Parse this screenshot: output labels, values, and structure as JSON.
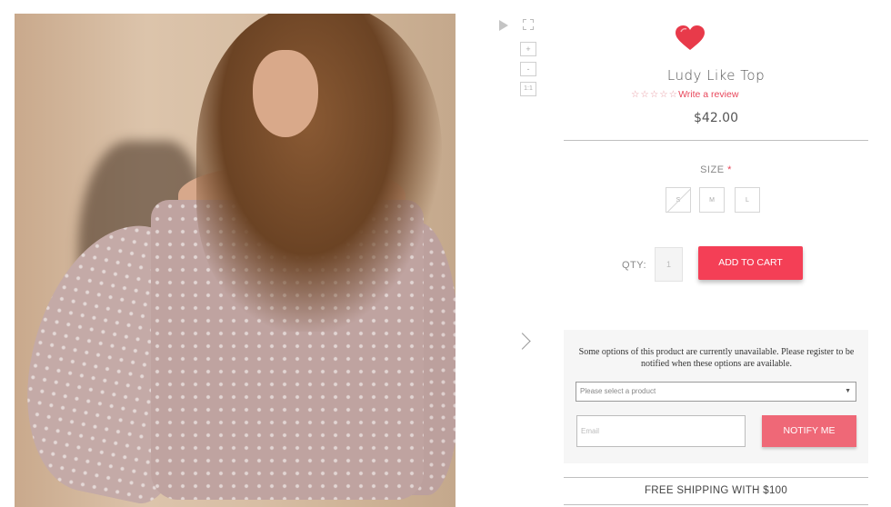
{
  "product": {
    "name": "Ludy Like Top",
    "rating_stars": "☆☆☆☆☆",
    "write_review": "Write a review",
    "price": "$42.00",
    "image_alt": "product-photo"
  },
  "gallery": {
    "zoom_in": "+",
    "zoom_out": "-",
    "reset": "1:1"
  },
  "options": {
    "size_label": "SIZE",
    "required_mark": "*",
    "sizes": [
      "S",
      "M",
      "L"
    ]
  },
  "purchase": {
    "qty_label": "QTY:",
    "qty_value": "1",
    "add_to_cart": "ADD TO CART"
  },
  "notify": {
    "message": "Some options of this product are currently unavailable. Please register to be notified when these options are available.",
    "select_placeholder": "Please select a product",
    "email_placeholder": "Email",
    "button": "NOTIFY ME"
  },
  "promo": {
    "free_shipping": "FREE SHIPPING WITH $100"
  },
  "colors": {
    "accent": "#f43f56",
    "notify_button": "#ef6877",
    "heart": "#e83a4a"
  }
}
